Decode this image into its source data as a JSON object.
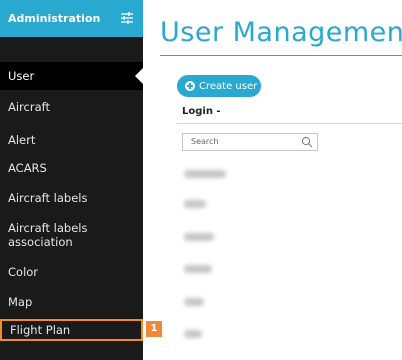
{
  "sidebar": {
    "title": "Administration",
    "items": [
      {
        "label": "User",
        "state": "active"
      },
      {
        "label": "Aircraft"
      },
      {
        "label": "Alert"
      },
      {
        "label": "ACARS"
      },
      {
        "label": "Aircraft labels"
      },
      {
        "label": "Aircraft labels association"
      },
      {
        "label": "Color"
      },
      {
        "label": "Map"
      },
      {
        "label": "Flight Plan",
        "state": "highlighted"
      }
    ]
  },
  "callout": {
    "number": "1"
  },
  "main": {
    "title": "User Management",
    "create_button_label": "Create user",
    "column_header": "Login -",
    "search_placeholder": "Search",
    "row_count": 7,
    "rows_redacted": true
  },
  "colors": {
    "accent": "#29a9cf",
    "sidebar_bg": "#1a1a1a",
    "highlight": "#f28c28"
  },
  "icons": [
    "settings-sliders-icon",
    "plus-icon",
    "search-icon"
  ]
}
